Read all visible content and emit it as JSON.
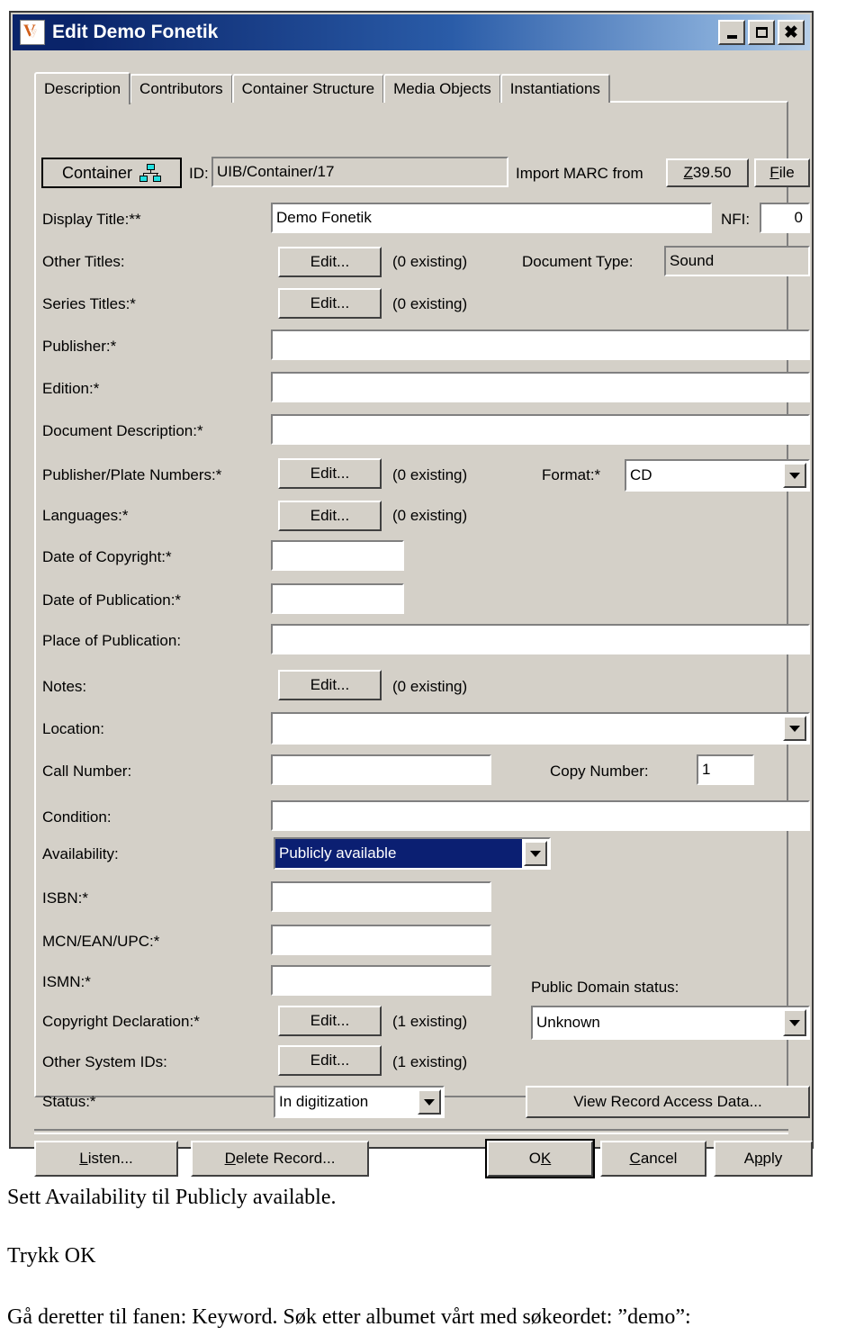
{
  "window": {
    "title": "Edit Demo Fonetik",
    "app_icon": "vital-v-icon",
    "controls": {
      "minimize": "minimize-icon",
      "maximize": "maximize-icon",
      "close": "close-icon"
    }
  },
  "tabs": [
    {
      "label": "Description",
      "selected": true
    },
    {
      "label": "Contributors",
      "selected": false
    },
    {
      "label": "Container Structure",
      "selected": false
    },
    {
      "label": "Media Objects",
      "selected": false
    },
    {
      "label": "Instantiations",
      "selected": false
    }
  ],
  "toolbar": {
    "container_button": "Container",
    "container_icon": "hierarchy-icon",
    "id_label": "ID:",
    "id_value": "UIB/Container/17",
    "import_label": "Import MARC from",
    "import_z3950": "Z39.50",
    "import_z3950_accel": "Z",
    "import_z3950_rest": "39.50",
    "import_file": "File",
    "import_file_accel": "F",
    "import_file_rest": "ile"
  },
  "form": {
    "display_title": {
      "label": "Display Title:**",
      "value": "Demo Fonetik"
    },
    "nfi": {
      "label": "NFI:",
      "value": "0"
    },
    "other_titles": {
      "label": "Other Titles:",
      "button": "Edit...",
      "count": "(0 existing)"
    },
    "document_type": {
      "label": "Document Type:",
      "value": "Sound"
    },
    "series_titles": {
      "label": "Series Titles:*",
      "button": "Edit...",
      "count": "(0 existing)"
    },
    "publisher": {
      "label": "Publisher:*",
      "value": ""
    },
    "edition": {
      "label": "Edition:*",
      "value": ""
    },
    "document_description": {
      "label": "Document Description:*",
      "value": ""
    },
    "publisher_plate_numbers": {
      "label": "Publisher/Plate Numbers:*",
      "button": "Edit...",
      "count": "(0 existing)"
    },
    "format": {
      "label": "Format:*",
      "value": "CD"
    },
    "languages": {
      "label": "Languages:*",
      "button": "Edit...",
      "count": "(0 existing)"
    },
    "date_of_copyright": {
      "label": "Date of Copyright:*",
      "value": ""
    },
    "date_of_publication": {
      "label": "Date of Publication:*",
      "value": ""
    },
    "place_of_publication": {
      "label": "Place of Publication:",
      "value": ""
    },
    "notes": {
      "label": "Notes:",
      "button": "Edit...",
      "count": "(0 existing)"
    },
    "location": {
      "label": "Location:",
      "value": ""
    },
    "call_number": {
      "label": "Call Number:",
      "value": ""
    },
    "copy_number": {
      "label": "Copy Number:",
      "value": "1"
    },
    "condition": {
      "label": "Condition:",
      "value": ""
    },
    "availability": {
      "label": "Availability:",
      "value": "Publicly available",
      "highlight_color": "#0b1f72"
    },
    "isbn": {
      "label": "ISBN:*",
      "value": ""
    },
    "mcn_ean_upc": {
      "label": "MCN/EAN/UPC:*",
      "value": ""
    },
    "ismn": {
      "label": "ISMN:*",
      "value": ""
    },
    "public_domain_status": {
      "label": "Public Domain status:",
      "value": "Unknown"
    },
    "copyright_declaration": {
      "label": "Copyright Declaration:*",
      "button": "Edit...",
      "count": "(1 existing)"
    },
    "other_system_ids": {
      "label": "Other System IDs:",
      "button": "Edit...",
      "count": "(1 existing)"
    },
    "status": {
      "label": "Status:*",
      "value": "In digitization"
    },
    "view_record_access": {
      "label": "View Record Access Data..."
    }
  },
  "footer": {
    "listen": {
      "accel": "L",
      "rest": "isten..."
    },
    "delete_record": {
      "accel": "D",
      "rest": "elete Record..."
    },
    "ok": {
      "pre": "O",
      "accel": "K",
      "rest": ""
    },
    "cancel": {
      "pre": "",
      "accel": "C",
      "rest": "ancel"
    },
    "apply": {
      "pre": "A",
      "accel": "p",
      "rest": "ply"
    }
  },
  "caption": {
    "line1": "Sett Availability til Publicly available.",
    "line2": "Trykk OK",
    "line3": "Gå deretter til fanen: Keyword. Søk etter albumet vårt med søkeordet: ”demo”:"
  }
}
